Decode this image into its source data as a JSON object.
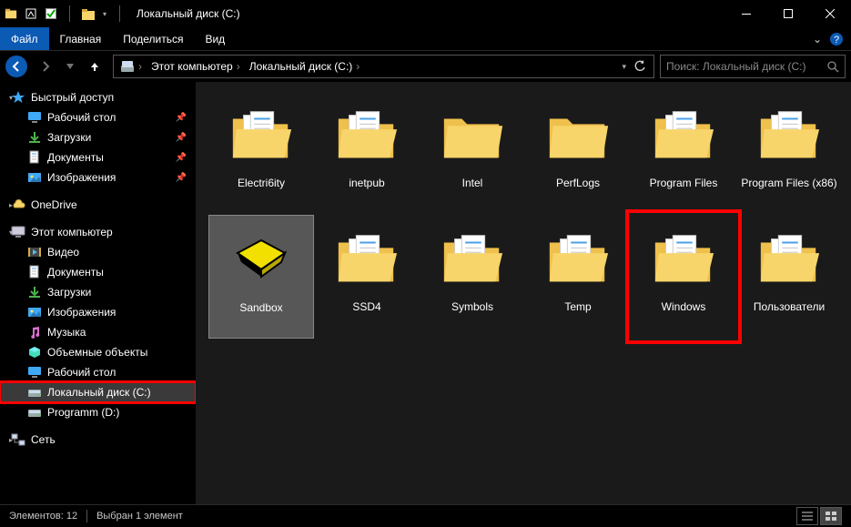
{
  "window": {
    "title": "Локальный диск (C:)"
  },
  "ribbon": {
    "file": "Файл",
    "tabs": [
      "Главная",
      "Поделиться",
      "Вид"
    ]
  },
  "breadcrumb": {
    "segments": [
      "Этот компьютер",
      "Локальный диск (C:)"
    ]
  },
  "search": {
    "placeholder": "Поиск: Локальный диск (C:)"
  },
  "sidebar": {
    "quick_access": {
      "label": "Быстрый доступ",
      "icon": "star-icon",
      "expanded": true
    },
    "quick_items": [
      {
        "label": "Рабочий стол",
        "icon": "desktop-icon",
        "pinned": true
      },
      {
        "label": "Загрузки",
        "icon": "downloads-icon",
        "pinned": true
      },
      {
        "label": "Документы",
        "icon": "documents-icon",
        "pinned": true
      },
      {
        "label": "Изображения",
        "icon": "pictures-icon",
        "pinned": true
      }
    ],
    "onedrive": {
      "label": "OneDrive",
      "icon": "onedrive-icon"
    },
    "this_pc": {
      "label": "Этот компьютер",
      "icon": "pc-icon",
      "expanded": true
    },
    "pc_items": [
      {
        "label": "Видео",
        "icon": "video-icon"
      },
      {
        "label": "Документы",
        "icon": "documents-icon"
      },
      {
        "label": "Загрузки",
        "icon": "downloads-icon"
      },
      {
        "label": "Изображения",
        "icon": "pictures-icon"
      },
      {
        "label": "Музыка",
        "icon": "music-icon"
      },
      {
        "label": "Объемные объекты",
        "icon": "3d-icon"
      },
      {
        "label": "Рабочий стол",
        "icon": "desktop-icon"
      },
      {
        "label": "Локальный диск (C:)",
        "icon": "disk-icon",
        "selected": true,
        "highlighted": true
      },
      {
        "label": "Programm (D:)",
        "icon": "disk-icon"
      }
    ],
    "network": {
      "label": "Сеть",
      "icon": "network-icon"
    }
  },
  "folders": [
    {
      "label": "Electri6ity",
      "type": "folder-docs"
    },
    {
      "label": "inetpub",
      "type": "folder-docs"
    },
    {
      "label": "Intel",
      "type": "folder"
    },
    {
      "label": "PerfLogs",
      "type": "folder"
    },
    {
      "label": "Program Files",
      "type": "folder-docs"
    },
    {
      "label": "Program Files (x86)",
      "type": "folder-docs"
    },
    {
      "label": "Sandbox",
      "type": "sandbox",
      "selected": true
    },
    {
      "label": "SSD4",
      "type": "folder-docs"
    },
    {
      "label": "Symbols",
      "type": "folder-docs"
    },
    {
      "label": "Temp",
      "type": "folder-docs"
    },
    {
      "label": "Windows",
      "type": "folder-docs",
      "highlighted": true
    },
    {
      "label": "Пользователи",
      "type": "folder-docs"
    }
  ],
  "status": {
    "count_label": "Элементов: 12",
    "selection_label": "Выбран 1 элемент"
  }
}
